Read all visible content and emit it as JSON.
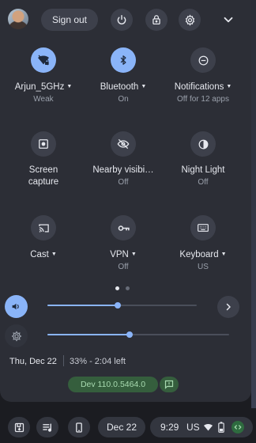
{
  "header": {
    "sign_out_label": "Sign out"
  },
  "tiles": [
    {
      "label": "Arjun_5GHz",
      "sub": "Weak",
      "icon": "wifi-locked-icon",
      "active": true,
      "has_menu": true
    },
    {
      "label": "Bluetooth",
      "sub": "On",
      "icon": "bluetooth-icon",
      "active": true,
      "has_menu": true
    },
    {
      "label": "Notifications",
      "sub": "Off for 12 apps",
      "icon": "notifications-off-icon",
      "active": false,
      "has_menu": true
    },
    {
      "label": "Screen",
      "label2": "capture",
      "sub": "",
      "icon": "screen-capture-icon",
      "active": false,
      "has_menu": false
    },
    {
      "label": "Nearby visibi…",
      "sub": "Off",
      "icon": "nearby-visibility-off-icon",
      "active": false,
      "has_menu": false
    },
    {
      "label": "Night Light",
      "sub": "Off",
      "icon": "night-light-icon",
      "active": false,
      "has_menu": false
    },
    {
      "label": "Cast",
      "sub": "",
      "icon": "cast-icon",
      "active": false,
      "has_menu": true
    },
    {
      "label": "VPN",
      "sub": "Off",
      "icon": "vpn-key-icon",
      "active": false,
      "has_menu": true
    },
    {
      "label": "Keyboard",
      "sub": "US",
      "icon": "keyboard-icon",
      "active": false,
      "has_menu": true
    }
  ],
  "pager": {
    "current_page": 1,
    "total_pages": 2
  },
  "sliders": {
    "volume_level": 0.47,
    "brightness_level": 0.45
  },
  "footer": {
    "date": "Thu, Dec 22",
    "battery": "33% - 2:04 left",
    "channel": "Dev 110.0.5464.0"
  },
  "shelf": {
    "date": "Dec 22",
    "time": "9:29",
    "region": "US"
  },
  "colors": {
    "accent": "#8ab4f8",
    "panel": "#2c2e36",
    "button": "#3d404b",
    "dev_badge": "#355e3d"
  }
}
